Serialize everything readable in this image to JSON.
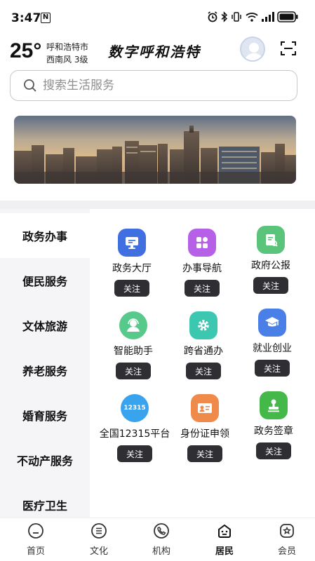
{
  "status_bar": {
    "time": "3:47",
    "nfc": "N",
    "icons": [
      "alarm-icon",
      "bluetooth-icon",
      "vibrate-icon",
      "wifi-icon",
      "signal-icon",
      "battery-icon"
    ]
  },
  "header": {
    "temperature": "25°",
    "city": "呼和浩特市",
    "wind": "西南风 3级",
    "title": "数字呼和浩特",
    "avatar_icon": "user-avatar-icon",
    "scan_icon": "scan-icon"
  },
  "search": {
    "placeholder": "搜索生活服务",
    "icon": "search-icon"
  },
  "banner": {
    "icon": "city-skyline-image"
  },
  "sidebar": {
    "items": [
      {
        "label": "政务办事",
        "active": true
      },
      {
        "label": "便民服务",
        "active": false
      },
      {
        "label": "文体旅游",
        "active": false
      },
      {
        "label": "养老服务",
        "active": false
      },
      {
        "label": "婚育服务",
        "active": false
      },
      {
        "label": "不动产服务",
        "active": false
      },
      {
        "label": "医疗卫生",
        "active": false
      }
    ]
  },
  "services": [
    {
      "label": "政务大厅",
      "icon": "government-hall-icon",
      "color": "#3f6fe0",
      "follow": "关注"
    },
    {
      "label": "办事导航",
      "icon": "navigation-grid-icon",
      "color": "#b560e6",
      "follow": "关注"
    },
    {
      "label": "政府公报",
      "icon": "bulletin-icon",
      "color": "#5ac47a",
      "follow": "关注"
    },
    {
      "label": "智能助手",
      "icon": "assistant-icon",
      "color": "#57c98a",
      "follow": "关注"
    },
    {
      "label": "跨省通办",
      "icon": "gear-icon",
      "color": "#3cc8b0",
      "follow": "关注"
    },
    {
      "label": "就业创业",
      "icon": "graduation-cap-icon",
      "color": "#4a7fe8",
      "follow": "关注"
    },
    {
      "label": "全国12315平台",
      "icon": "badge-12315-icon",
      "color": "#3aa3ee",
      "follow": "关注",
      "icon_text": "12315"
    },
    {
      "label": "身份证申领",
      "icon": "id-card-icon",
      "color": "#f08a4b",
      "follow": "关注"
    },
    {
      "label": "政务签章",
      "icon": "stamp-icon",
      "color": "#45b84a",
      "follow": "关注"
    }
  ],
  "bottom_nav": {
    "items": [
      {
        "label": "首页",
        "icon": "home-icon",
        "active": false
      },
      {
        "label": "文化",
        "icon": "culture-icon",
        "active": false
      },
      {
        "label": "机构",
        "icon": "phone-icon",
        "active": false
      },
      {
        "label": "居民",
        "icon": "resident-icon",
        "active": true
      },
      {
        "label": "会员",
        "icon": "member-badge-icon",
        "active": false
      }
    ]
  }
}
